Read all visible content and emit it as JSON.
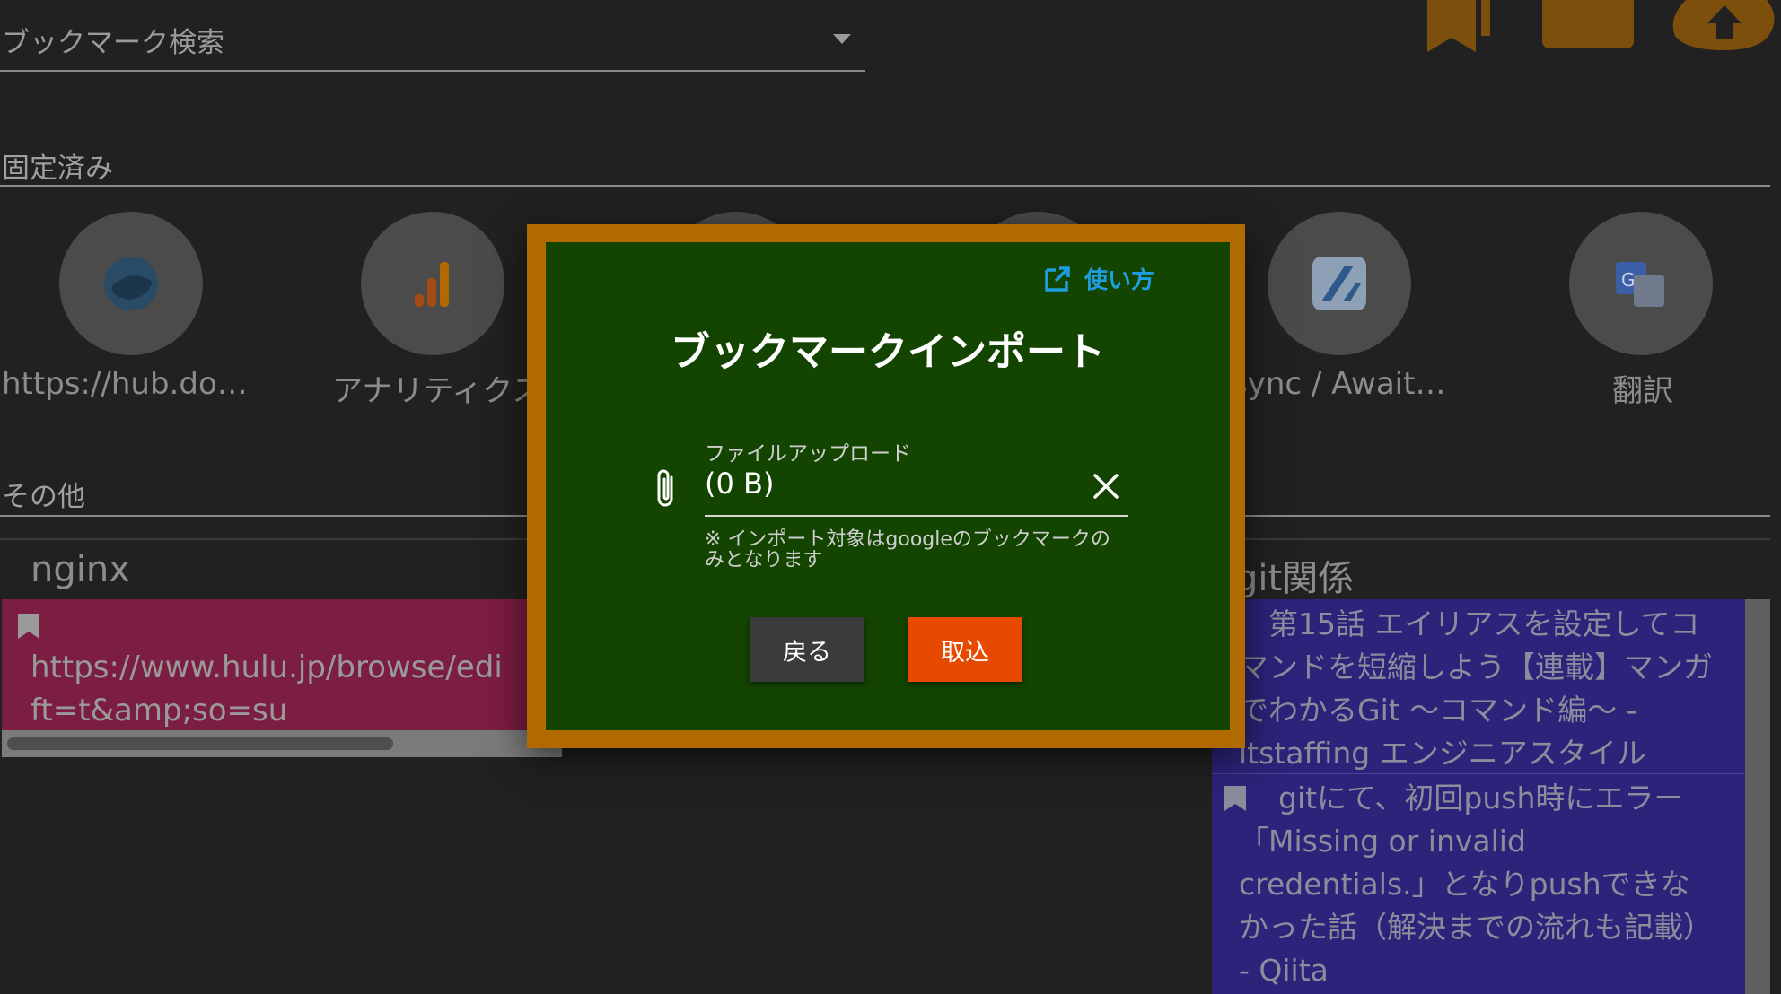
{
  "search": {
    "placeholder": "ブックマーク検索"
  },
  "toolbar_icons": [
    "bookmark-icon",
    "folder-icon",
    "cloud-upload-icon"
  ],
  "pinned": {
    "title": "固定済み",
    "items": [
      {
        "label": "https://hub.do…",
        "icon": "docker-icon"
      },
      {
        "label": "アナリティクス",
        "icon": "analytics-icon"
      },
      {
        "label": "sync / Await…",
        "icon": "zenn-icon"
      },
      {
        "label": "翻訳",
        "icon": "translate-icon"
      }
    ]
  },
  "others": {
    "title": "その他",
    "cards": [
      {
        "title": "nginx",
        "color": "#7c1d42",
        "link": "https://www.hulu.jp/browse/edi\nft=t&amp;so=su"
      },
      {
        "title": "git関係",
        "color": "#2c237a",
        "links": [
          "　第15話 エイリアスを設定してコ\nマンドを短縮しよう【連載】マンガ\nでわかるGit ～コマンド編～ -\nitstaffing エンジニアスタイル",
          "gitにて、初回push時にエラー\n「Missing or invalid\ncredentials.」となりpushできな\nかった話（解決までの流れも記載）\n- Qiita"
        ]
      }
    ]
  },
  "dialog": {
    "help_label": "使い方",
    "title": "ブックマークインポート",
    "field_label": "ファイルアップロード",
    "field_value": "(0 B)",
    "note": "※ インポート対象はgoogleのブックマークのみとなります",
    "back_button": "戻る",
    "import_button": "取込",
    "colors": {
      "frame": "#b06a00",
      "background": "#134400",
      "accent": "#e64a00",
      "link": "#1e9ee0"
    }
  }
}
